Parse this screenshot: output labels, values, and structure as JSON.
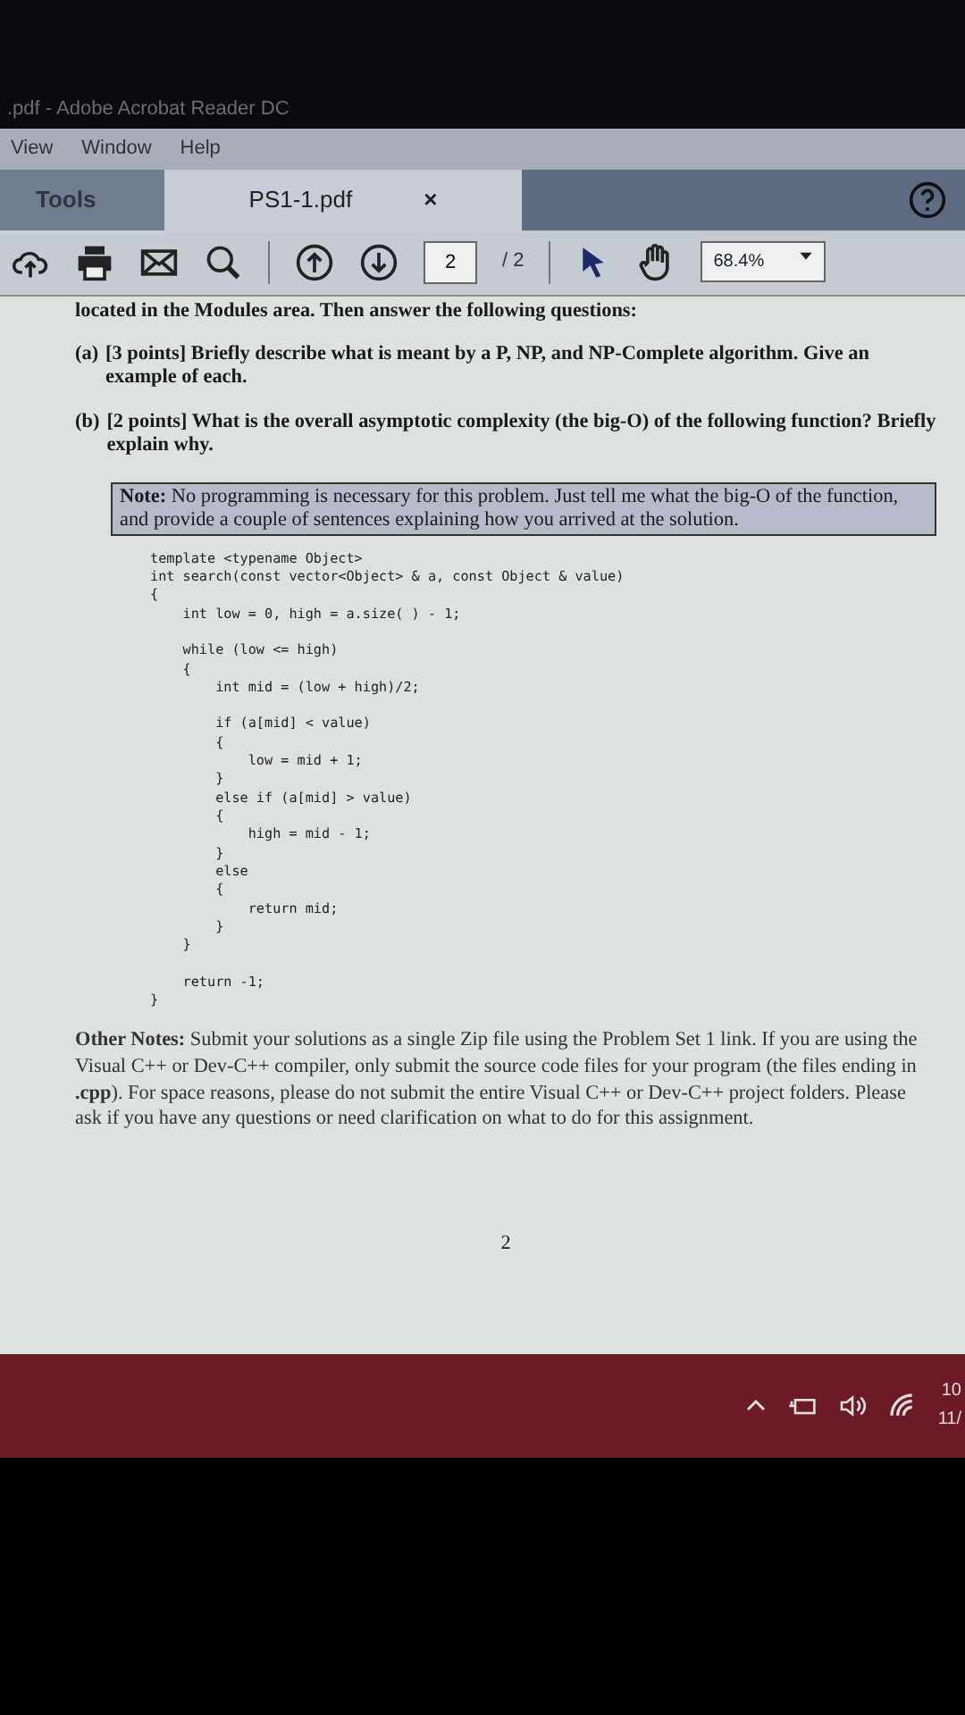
{
  "window": {
    "title": ".pdf - Adobe Acrobat Reader DC"
  },
  "menu": [
    "View",
    "Window",
    "Help"
  ],
  "tabs": [
    {
      "label": "Tools",
      "selected": false
    },
    {
      "label": "PS1-1.pdf",
      "selected": true,
      "close": "×"
    }
  ],
  "toolbar": {
    "page": "2",
    "page_total": "/ 2",
    "zoom": "68.4%"
  },
  "document": {
    "intro": "located in the Modules area. Then answer the following questions:",
    "questions": [
      {
        "label": "(a)",
        "text": "[3 points] Briefly describe what is meant by a P, NP, and NP-Complete algorithm. Give an example of each."
      },
      {
        "label": "(b)",
        "text": "[2 points] What is the overall asymptotic complexity (the big-O) of the following function? Briefly explain why."
      }
    ],
    "note": "**Note:** No programming is necessary for this problem. Just tell me what the big-O of the function, and provide a couple of sentences explaining how you arrived at the solution.",
    "code": [
      "template <typename Object>",
      "int search(const vector<Object> & a, const Object & value)",
      "{",
      "    int low = 0, high = a.size( ) - 1;\n",
      "    while (low <= high)",
      "    {",
      "        int mid = (low + high)/2;\n",
      "        if (a[mid] < value)",
      "        {",
      "            low = mid + 1;",
      "        }",
      "        else if (a[mid] > value)",
      "        {",
      "            high = mid - 1;",
      "        }",
      "        else",
      "        {",
      "            return mid;",
      "        }",
      "    }\n",
      "    return -1;",
      "}"
    ],
    "other_notes": "**Other Notes:** Submit your solutions as a single Zip file using the Problem Set 1 link. If you are using the Visual C++ or Dev-C++ compiler, only submit the source code files for your program (the files ending in **.cpp**). For space reasons, please do not submit the entire Visual C++ or Dev-C++ project folders. Please ask if you have any questions or need clarification on what to do for this assignment.",
    "page_number": "2"
  },
  "taskbar": {
    "clock_time": "10",
    "clock_date": "11/"
  }
}
